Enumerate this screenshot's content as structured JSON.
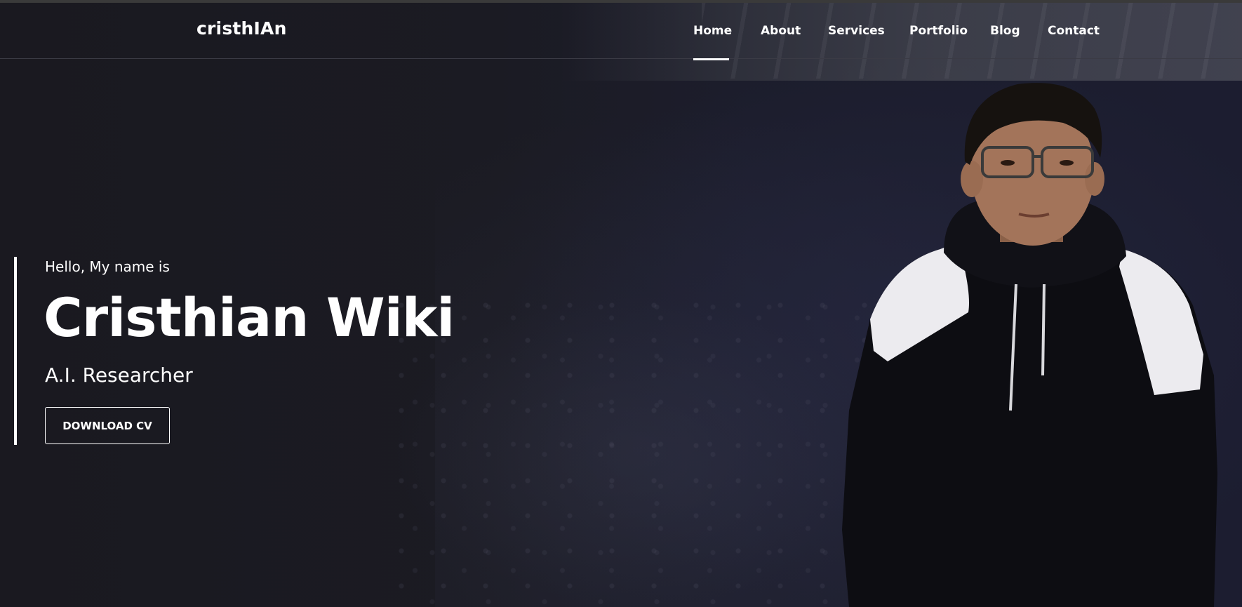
{
  "header": {
    "brand": "cristhIAn",
    "nav": [
      {
        "label": "Home",
        "active": true
      },
      {
        "label": "About",
        "active": false
      },
      {
        "label": "Services",
        "active": false
      },
      {
        "label": "Portfolio",
        "active": false
      },
      {
        "label": "Blog",
        "active": false
      },
      {
        "label": "Contact",
        "active": false
      }
    ]
  },
  "hero": {
    "greeting": "Hello, My name is",
    "name": "Cristhian Wiki",
    "role": "A.I. Researcher",
    "cta_label": "DOWNLOAD CV"
  },
  "colors": {
    "background": "#1b1a22",
    "text": "#ffffff",
    "accent": "#ffffff"
  }
}
